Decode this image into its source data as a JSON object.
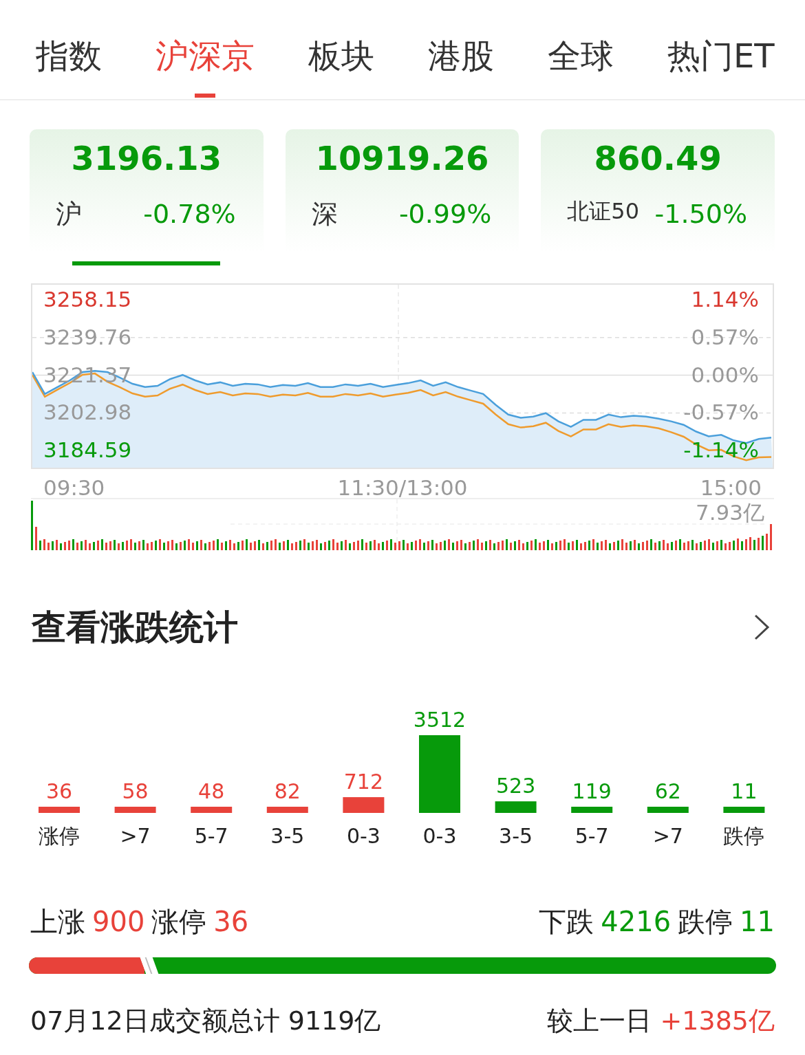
{
  "tabs": [
    {
      "label": "指数",
      "selected": false
    },
    {
      "label": "沪深京",
      "selected": true
    },
    {
      "label": "板块",
      "selected": false
    },
    {
      "label": "港股",
      "selected": false
    },
    {
      "label": "全球",
      "selected": false
    },
    {
      "label": "热门ET",
      "selected": false
    }
  ],
  "index_cards": [
    {
      "value": "3196.13",
      "name": "沪",
      "change": "-0.78%",
      "selected": true
    },
    {
      "value": "10919.26",
      "name": "深",
      "change": "-0.99%",
      "selected": false
    },
    {
      "value": "860.49",
      "name": "北证50",
      "change": "-1.50%",
      "selected": false
    }
  ],
  "intraday_chart": {
    "percent_labels": [
      {
        "text": "1.14%",
        "kind": "up"
      },
      {
        "text": "0.57%",
        "kind": "flat"
      },
      {
        "text": "0.00%",
        "kind": "flat"
      },
      {
        "text": "-0.57%",
        "kind": "flat"
      },
      {
        "text": "-1.14%",
        "kind": "down"
      }
    ],
    "time_labels": [
      "09:30",
      "11:30/13:00",
      "15:00"
    ],
    "volume_label": "7.93亿",
    "chart_data": {
      "type": "line",
      "ylim": [
        3176.3,
        3265.5
      ],
      "yticks": [
        {
          "value": 3258.15,
          "label": "3258.15"
        },
        {
          "value": 3239.76,
          "label": "3239.76"
        },
        {
          "value": 3221.37,
          "label": "3221.37"
        },
        {
          "value": 3202.98,
          "label": "3202.98"
        },
        {
          "value": 3184.59,
          "label": "3184.59"
        }
      ],
      "ref_lines": [
        {
          "axis": "y",
          "value": 3221.37
        }
      ],
      "series": [
        {
          "color": "#4a9fdb",
          "values": [
            3222.9,
            3212.2,
            3215.6,
            3218.9,
            3222.9,
            3223.5,
            3222.9,
            3220.2,
            3217.2,
            3215.6,
            3216.2,
            3219.5,
            3221.5,
            3218.9,
            3216.9,
            3217.9,
            3216.2,
            3217.2,
            3216.9,
            3215.6,
            3216.6,
            3216.2,
            3217.5,
            3215.6,
            3215.6,
            3216.9,
            3216.2,
            3217.2,
            3215.6,
            3216.6,
            3217.5,
            3218.9,
            3216.2,
            3217.9,
            3215.6,
            3213.9,
            3212.2,
            3206.9,
            3202.2,
            3200.6,
            3201.2,
            3202.9,
            3198.9,
            3196.2,
            3199.6,
            3199.6,
            3202.2,
            3200.9,
            3201.6,
            3201.2,
            3200.2,
            3198.9,
            3197.2,
            3193.9,
            3191.6,
            3192.3,
            3189.6,
            3188.3,
            3190.3,
            3191.0
          ]
        },
        {
          "color": "#ef9b2d",
          "values": [
            3221.6,
            3210.9,
            3214.3,
            3217.6,
            3221.6,
            3222.2,
            3218.2,
            3215.5,
            3212.5,
            3210.9,
            3211.5,
            3214.8,
            3216.8,
            3214.2,
            3212.2,
            3213.2,
            3211.5,
            3212.5,
            3212.2,
            3210.9,
            3211.9,
            3211.5,
            3212.8,
            3210.9,
            3210.9,
            3212.2,
            3211.5,
            3212.5,
            3210.9,
            3211.9,
            3212.8,
            3214.2,
            3211.5,
            3213.2,
            3210.9,
            3209.2,
            3207.5,
            3202.2,
            3197.5,
            3195.9,
            3196.5,
            3198.2,
            3194.2,
            3191.5,
            3194.9,
            3194.9,
            3197.5,
            3196.2,
            3196.9,
            3196.5,
            3195.5,
            3193.6,
            3191.4,
            3187.6,
            3184.8,
            3185.0,
            3181.8,
            3179.9,
            3181.3,
            3181.5
          ]
        }
      ]
    }
  },
  "stats": {
    "title": "查看涨跌统计",
    "distribution": [
      {
        "count": "36",
        "label": "涨停",
        "color": "#e8423a"
      },
      {
        "count": "58",
        "label": ">7",
        "color": "#e8423a"
      },
      {
        "count": "48",
        "label": "5-7",
        "color": "#e8423a"
      },
      {
        "count": "82",
        "label": "3-5",
        "color": "#e8423a"
      },
      {
        "count": "712",
        "label": "0-3",
        "color": "#e8423a"
      },
      {
        "count": "3512",
        "label": "0-3",
        "color": "#079a0b"
      },
      {
        "count": "523",
        "label": "3-5",
        "color": "#079a0b"
      },
      {
        "count": "119",
        "label": "5-7",
        "color": "#079a0b"
      },
      {
        "count": "62",
        "label": ">7",
        "color": "#079a0b"
      },
      {
        "count": "11",
        "label": "跌停",
        "color": "#079a0b"
      }
    ],
    "rise_label": "上涨",
    "rise_count": "900",
    "limit_up_label": "涨停",
    "limit_up_count": "36",
    "fall_label": "下跌",
    "fall_count": "4216",
    "limit_down_label": "跌停",
    "limit_down_count": "11",
    "ratio_bar": {
      "level": 0.155
    },
    "turnover_label": "07月12日成交额总计",
    "turnover_value": "9119亿",
    "compare_label": "较上一日",
    "compare_value": "+1385亿"
  }
}
